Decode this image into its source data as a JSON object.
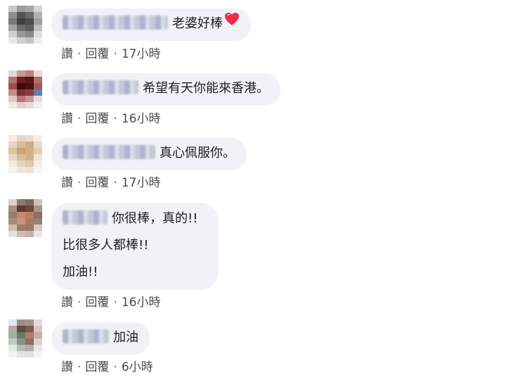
{
  "comments": [
    {
      "text": "老婆好棒",
      "has_heart": true,
      "like": "讚",
      "reply": "回覆",
      "time": "17小時"
    },
    {
      "text": "希望有天你能來香港。",
      "has_heart": false,
      "like": "讚",
      "reply": "回覆",
      "time": "16小時"
    },
    {
      "text": "真心佩服你。",
      "has_heart": false,
      "like": "讚",
      "reply": "回覆",
      "time": "17小時"
    },
    {
      "lines": [
        "你很棒，真的!!",
        "比很多人都棒!!",
        "加油!!"
      ],
      "like": "讚",
      "reply": "回覆",
      "time": "16小時"
    },
    {
      "text": "加油",
      "has_heart": false,
      "like": "讚",
      "reply": "回覆",
      "time": "6小時"
    }
  ],
  "separator": "·",
  "icons": {
    "heart": "heart-icon"
  },
  "colors": {
    "bubble": "#f0f2f5",
    "heart": "#f0284a",
    "meta_text": "#4a4b4d"
  }
}
